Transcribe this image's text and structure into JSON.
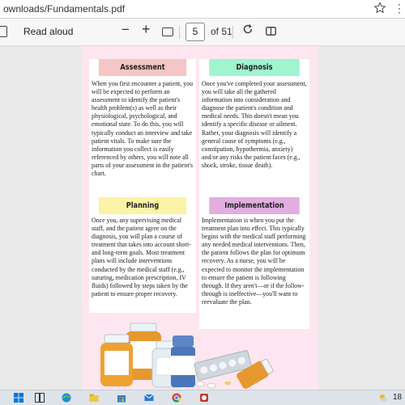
{
  "browser": {
    "url": "ownloads/Fundamentals.pdf"
  },
  "toolbar": {
    "read_aloud": "Read aloud",
    "zoom_out": "−",
    "zoom_in": "+",
    "page_number": "5",
    "page_total": "of 51"
  },
  "sections": [
    {
      "title": "Assessment",
      "color": "#f5c6c6",
      "text": "When you first encounter a patient, you will be expected to perform an assessment to identify the patient's health problem(s) as well as their physiological, psychological, and emotional state. To do this, you will typically conduct an interview and take patient vitals. To make sure the information you collect is easily referenced by others, you will note all parts of your assessment in the patient's chart."
    },
    {
      "title": "Diagnosis",
      "color": "#9ef5cf",
      "text": "Once you've completed your assessment, you will take all the gathered information into consideration and diagnose the patient's condition and medical needs. This doesn't mean you identify a specific disease or ailment. Rather, your diagnosis will identify a general cause of symptoms (e.g., constipation, hypothermia, anxiety) and/or any risks the patient faces (e.g., shock, stroke, tissue death)."
    },
    {
      "title": "Planning",
      "color": "#fbf3a6",
      "text": "Once you, any supervising medical staff, and the patient agree on the diagnosis, you will plan a course of treatment that takes into account short- and long-term goals. Most treatment plans will include interventions conducted by the medical staff (e.g., suturing, medication prescription, IV fluids) followed by steps taken by the patient to ensure proper recovery."
    },
    {
      "title": "Implementation",
      "color": "#e2aee0",
      "text": "Implementation is when you put the treatment plan into effect. This typically begins with the medical staff performing any needed medical interventions. Then, the patient follows the plan for optimum recovery. As a nurse, you will be expected to monitor the implementation to ensure the patient is following through. If they aren't—or if the follow-through is ineffective—you'll want to reevaluate the plan."
    }
  ],
  "taskbar": {
    "clock": "18"
  }
}
